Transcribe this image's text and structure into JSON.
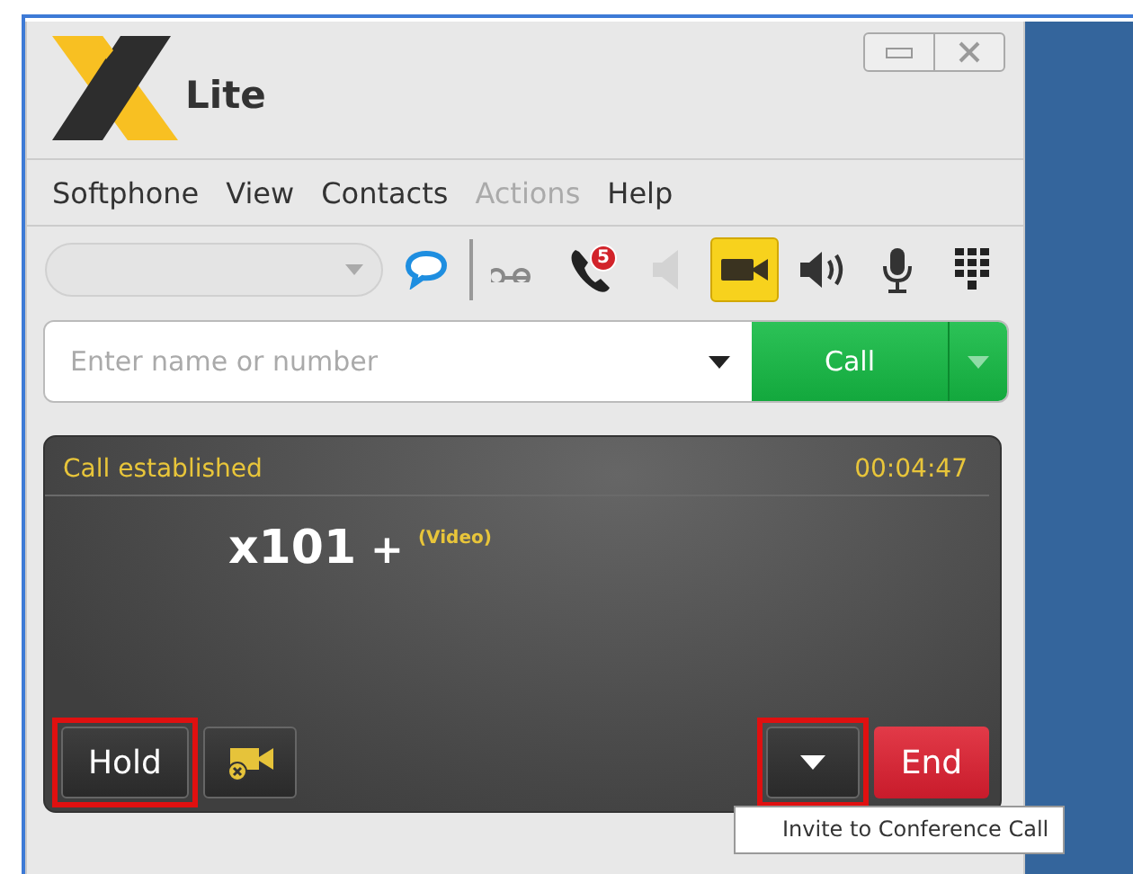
{
  "window": {
    "title": "Lite"
  },
  "menu": [
    {
      "label": "Softphone",
      "disabled": false
    },
    {
      "label": "View",
      "disabled": false
    },
    {
      "label": "Contacts",
      "disabled": false
    },
    {
      "label": "Actions",
      "disabled": true
    },
    {
      "label": "Help",
      "disabled": false
    }
  ],
  "toolbar": {
    "account_dropdown": {
      "disabled": true
    },
    "buttons": [
      {
        "kind": "chat",
        "on": false,
        "disabled": false
      },
      {
        "kind": "voicemail",
        "on": false,
        "disabled": false
      },
      {
        "kind": "missed_calls",
        "on": false,
        "disabled": false,
        "badge": "5"
      },
      {
        "kind": "speaker",
        "on": false,
        "disabled": true
      },
      {
        "kind": "video",
        "on": true,
        "disabled": false
      },
      {
        "kind": "speaker",
        "on": false,
        "disabled": false
      },
      {
        "kind": "microphone",
        "on": false,
        "disabled": false
      },
      {
        "kind": "keypad",
        "on": false,
        "disabled": false
      }
    ]
  },
  "dial": {
    "placeholder": "Enter name or number",
    "call_button": "Call"
  },
  "call": {
    "status": "Call established",
    "duration": "00:04:47",
    "party": "x101",
    "add_symbol": "+",
    "media": "(Video)",
    "buttons": [
      {
        "kind": "text",
        "label": "Hold",
        "highlighted": true
      },
      {
        "kind": "video_off",
        "highlighted": false
      },
      {
        "kind": "menu",
        "highlighted": true
      },
      {
        "kind": "end",
        "label": "End",
        "highlighted": false
      }
    ]
  },
  "tooltip": "Invite to Conference Call"
}
